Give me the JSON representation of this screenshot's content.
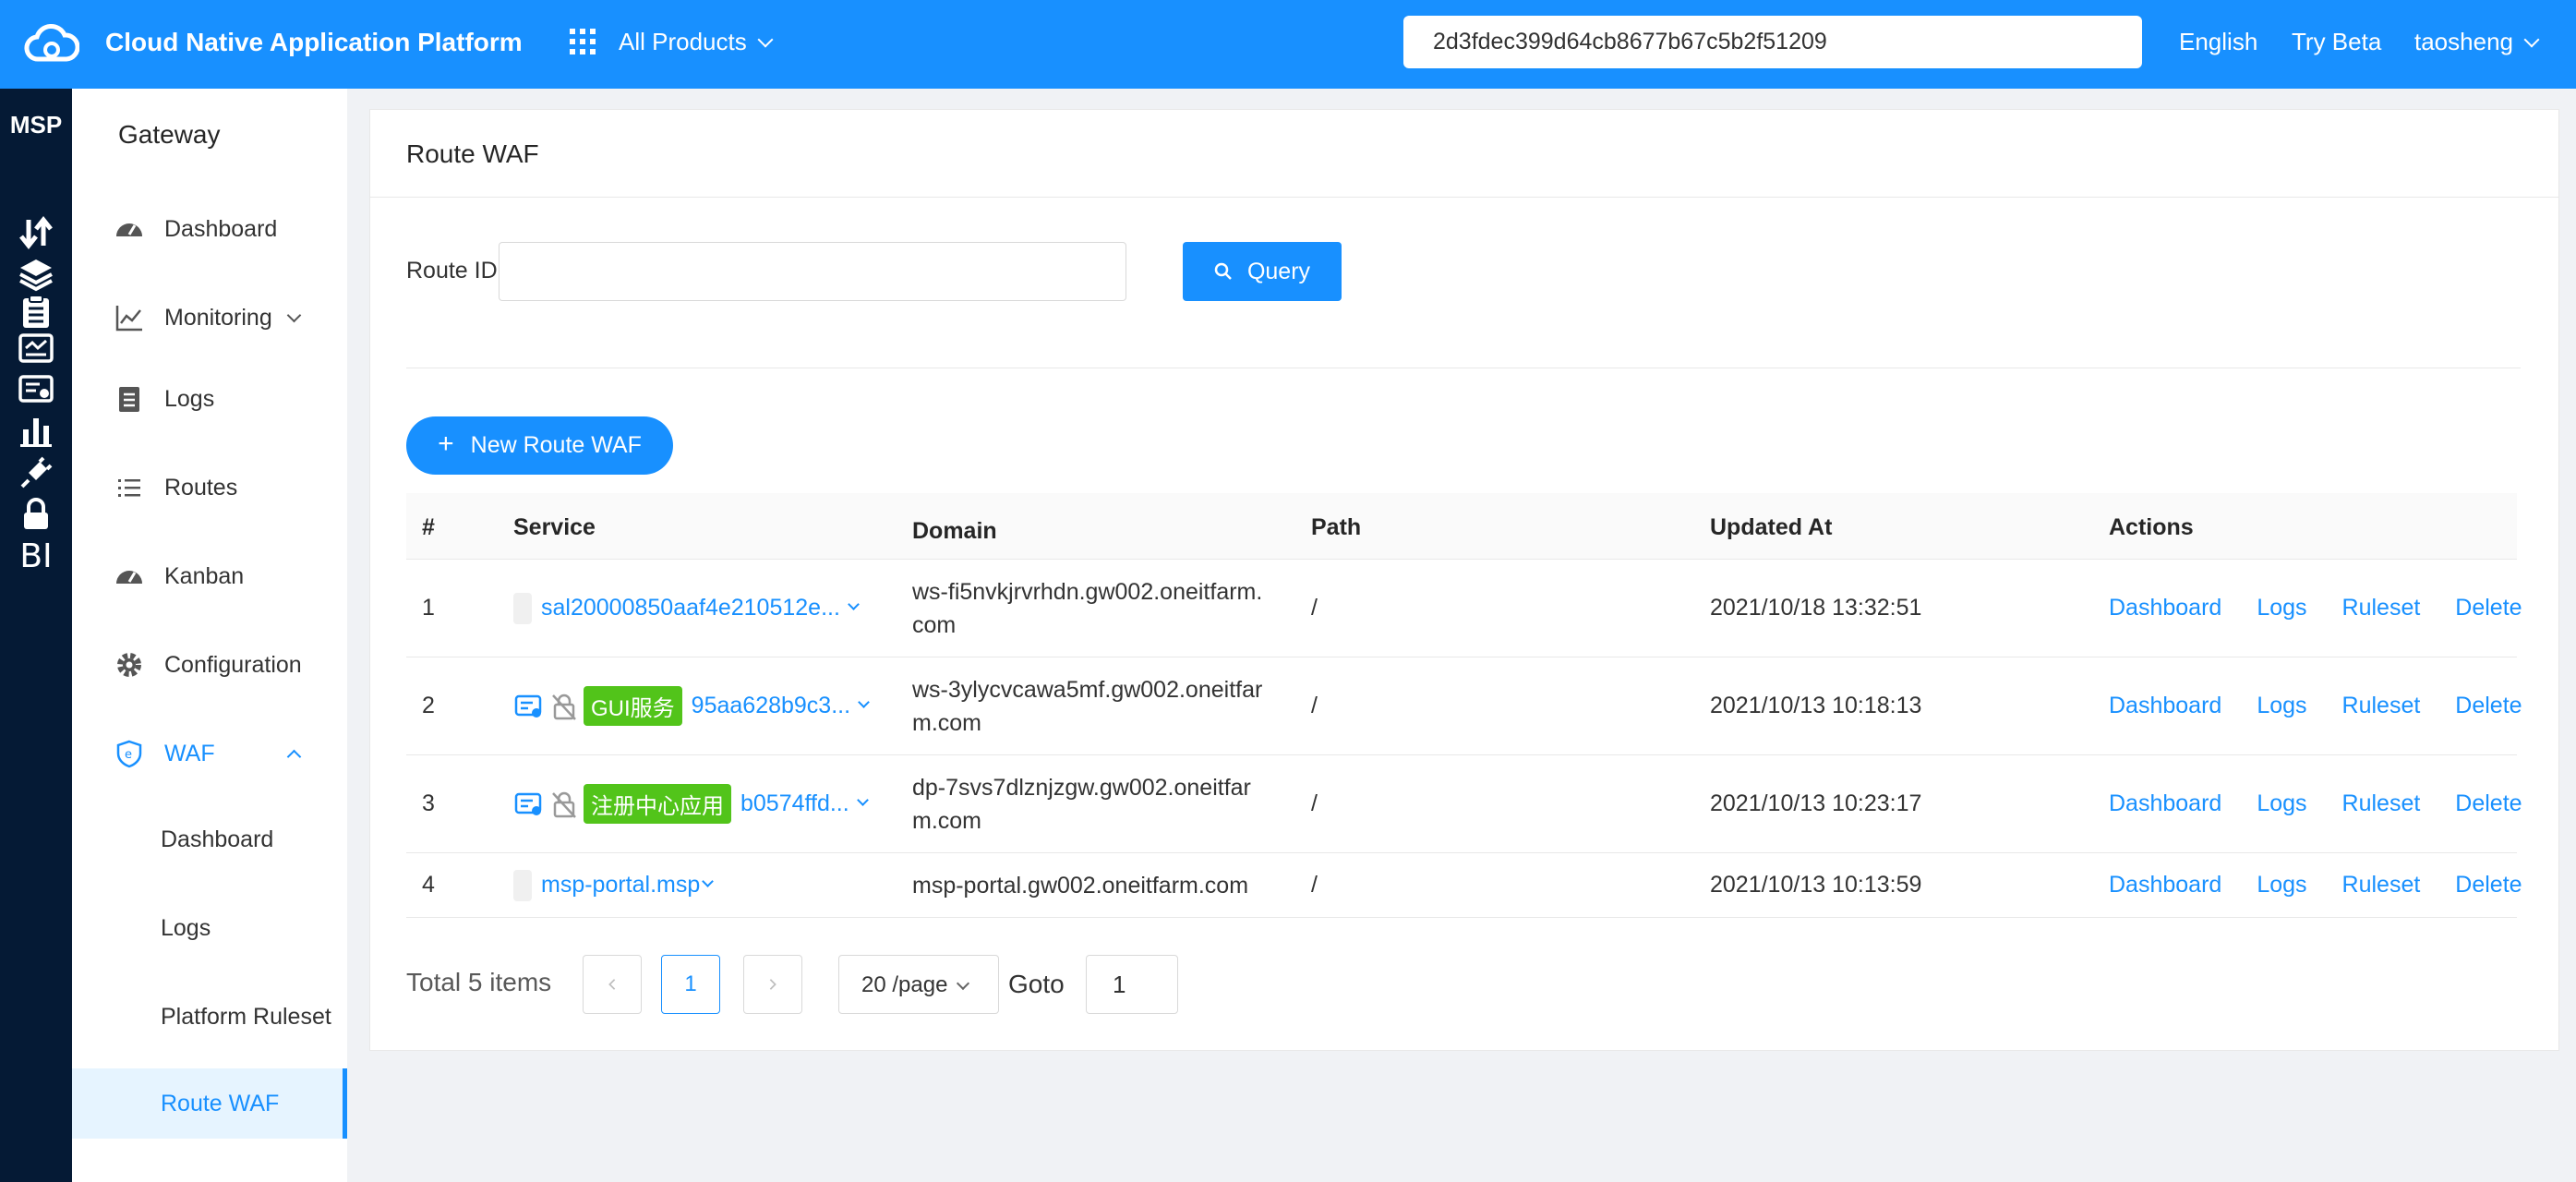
{
  "header": {
    "app_title": "Cloud Native Application Platform",
    "all_products": "All Products",
    "search_value": "2d3fdec399d64cb8677b67c5b2f51209",
    "language": "English",
    "try_beta": "Try Beta",
    "user": "taosheng",
    "brand_color": "#1890ff"
  },
  "rail": {
    "label": "MSP",
    "icons": [
      "transfer-icon",
      "layers-icon",
      "clipboard-icon",
      "monitor-icon",
      "certificate-icon",
      "bar-chart-icon",
      "api-plug-icon",
      "lock-icon",
      "bi-icon"
    ],
    "bi_text": "BI"
  },
  "sidebar": {
    "title": "Gateway",
    "items": [
      {
        "label": "Dashboard",
        "icon": "dashboard-gauge-icon"
      },
      {
        "label": "Monitoring",
        "icon": "line-chart-icon"
      },
      {
        "label": "Logs",
        "icon": "log-file-icon"
      },
      {
        "label": "Routes",
        "icon": "list-icon"
      },
      {
        "label": "Kanban",
        "icon": "dashboard-gauge-icon"
      },
      {
        "label": "Configuration",
        "icon": "gear-icon"
      },
      {
        "label": "WAF",
        "icon": "shield-icon"
      }
    ],
    "waf_sub": [
      {
        "label": "Dashboard"
      },
      {
        "label": "Logs"
      },
      {
        "label": "Platform Ruleset"
      },
      {
        "label": "Route WAF"
      }
    ]
  },
  "main": {
    "title": "Route WAF",
    "route_id_label": "Route ID",
    "route_id_value": "",
    "query_label": "Query",
    "new_label": "New Route WAF",
    "columns": [
      "#",
      "Service",
      "Domain",
      "Path",
      "Updated At",
      "Actions"
    ],
    "actions": [
      "Dashboard",
      "Logs",
      "Ruleset",
      "Delete"
    ],
    "rows": [
      {
        "no": "1",
        "tag": "",
        "service": "sal20000850aaf4e210512e...",
        "domain": "ws-fi5nvkjrvrhdn.gw002.oneitfarm.com",
        "domain_l1": "ws-fi5nvkjrvrhdn.gw002.oneitfarm.",
        "domain_l2": "com",
        "path": "/",
        "updated": "2021/10/18 13:32:51"
      },
      {
        "no": "2",
        "tag": "GUI服务",
        "service": "95aa628b9c3...",
        "domain_l1": "ws-3ylycvcawa5mf.gw002.oneitfar",
        "domain_l2": "m.com",
        "path": "/",
        "updated": "2021/10/13 10:18:13"
      },
      {
        "no": "3",
        "tag": "注册中心应用",
        "service": "b0574ffd...",
        "domain_l1": "dp-7svs7dlznjzgw.gw002.oneitfar",
        "domain_l2": "m.com",
        "path": "/",
        "updated": "2021/10/13 10:23:17"
      },
      {
        "no": "4",
        "tag": "",
        "service": "msp-portal.msp",
        "domain_l1": "msp-portal.gw002.oneitfarm.com",
        "domain_l2": "",
        "path": "/",
        "updated": "2021/10/13 10:13:59"
      }
    ],
    "pagination": {
      "total": "Total 5 items",
      "current_page": "1",
      "page_size": "20 /page",
      "goto_label": "Goto",
      "goto_value": "1"
    }
  }
}
